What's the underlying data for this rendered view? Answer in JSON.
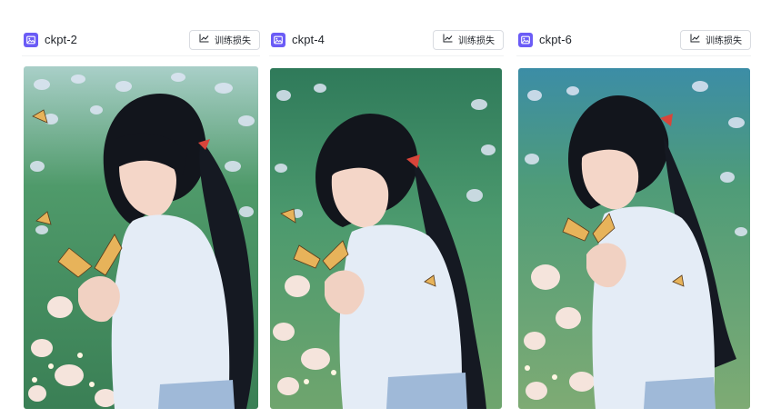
{
  "cards": [
    {
      "title": "ckpt-2",
      "button_label": "训练损失",
      "image_label": "girl-with-butterfly-image"
    },
    {
      "title": "ckpt-4",
      "button_label": "训练损失",
      "image_label": "girl-with-butterfly-image"
    },
    {
      "title": "ckpt-6",
      "button_label": "训练损失",
      "image_label": "girl-with-butterfly-image"
    }
  ],
  "colors": {
    "icon_accent": "#6b5cf6",
    "meadow_green": "#3f8a5c",
    "hair": "#12151c",
    "blouse": "#e4ecf6",
    "ribbon": "#d8453a",
    "butterfly": "#e7b35a"
  }
}
